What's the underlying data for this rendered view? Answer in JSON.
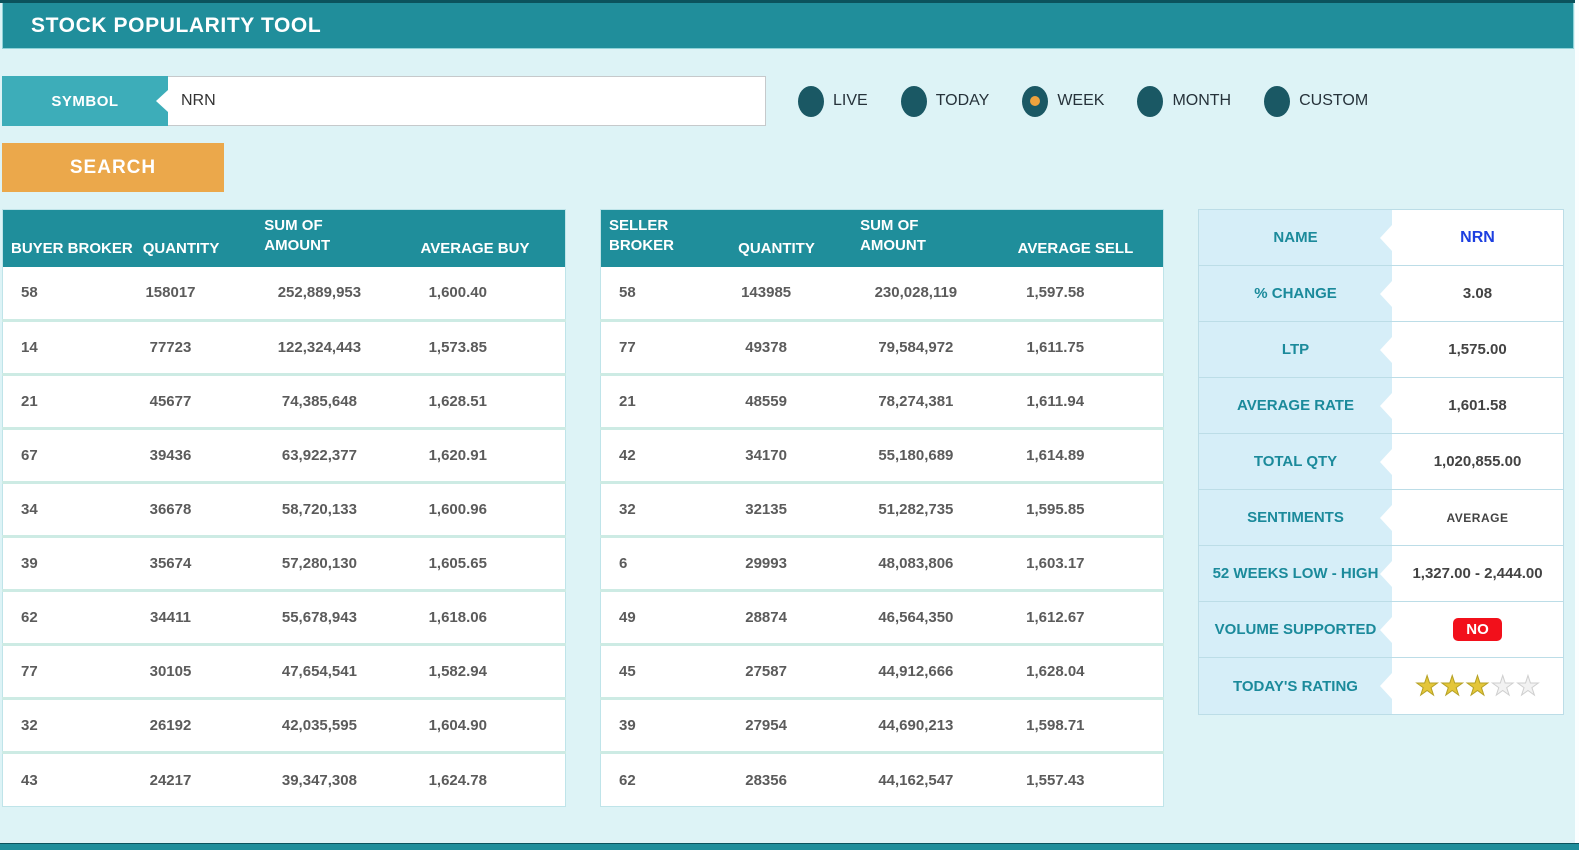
{
  "app": {
    "title": "STOCK POPULARITY TOOL"
  },
  "search": {
    "symbol_label": "SYMBOL",
    "symbol_value": "NRN",
    "search_button_label": "SEARCH"
  },
  "period_options": [
    {
      "label": "LIVE",
      "selected": false
    },
    {
      "label": "TODAY",
      "selected": false
    },
    {
      "label": "WEEK",
      "selected": true
    },
    {
      "label": "MONTH",
      "selected": false
    },
    {
      "label": "CUSTOM",
      "selected": false
    }
  ],
  "buyer_table": {
    "headers": [
      "BUYER BROKER",
      "QUANTITY",
      "SUM OF AMOUNT",
      "AVERAGE BUY"
    ],
    "rows": [
      [
        "58",
        "158017",
        "252,889,953",
        "1,600.40"
      ],
      [
        "14",
        "77723",
        "122,324,443",
        "1,573.85"
      ],
      [
        "21",
        "45677",
        "74,385,648",
        "1,628.51"
      ],
      [
        "67",
        "39436",
        "63,922,377",
        "1,620.91"
      ],
      [
        "34",
        "36678",
        "58,720,133",
        "1,600.96"
      ],
      [
        "39",
        "35674",
        "57,280,130",
        "1,605.65"
      ],
      [
        "62",
        "34411",
        "55,678,943",
        "1,618.06"
      ],
      [
        "77",
        "30105",
        "47,654,541",
        "1,582.94"
      ],
      [
        "32",
        "26192",
        "42,035,595",
        "1,604.90"
      ],
      [
        "43",
        "24217",
        "39,347,308",
        "1,624.78"
      ]
    ]
  },
  "seller_table": {
    "headers": [
      "SELLER BROKER",
      "QUANTITY",
      "SUM OF AMOUNT",
      "AVERAGE SELL"
    ],
    "rows": [
      [
        "58",
        "143985",
        "230,028,119",
        "1,597.58"
      ],
      [
        "77",
        "49378",
        "79,584,972",
        "1,611.75"
      ],
      [
        "21",
        "48559",
        "78,274,381",
        "1,611.94"
      ],
      [
        "42",
        "34170",
        "55,180,689",
        "1,614.89"
      ],
      [
        "32",
        "32135",
        "51,282,735",
        "1,595.85"
      ],
      [
        "6",
        "29993",
        "48,083,806",
        "1,603.17"
      ],
      [
        "49",
        "28874",
        "46,564,350",
        "1,612.67"
      ],
      [
        "45",
        "27587",
        "44,912,666",
        "1,628.04"
      ],
      [
        "39",
        "27954",
        "44,690,213",
        "1,598.71"
      ],
      [
        "62",
        "28356",
        "44,162,547",
        "1,557.43"
      ]
    ]
  },
  "summary_panel": {
    "rows": [
      {
        "label": "NAME",
        "value": "NRN",
        "type": "name"
      },
      {
        "label": "% CHANGE",
        "value": "3.08",
        "type": "text"
      },
      {
        "label": "LTP",
        "value": "1,575.00",
        "type": "text"
      },
      {
        "label": "AVERAGE RATE",
        "value": "1,601.58",
        "type": "text"
      },
      {
        "label": "TOTAL QTY",
        "value": "1,020,855.00",
        "type": "text"
      },
      {
        "label": "SENTIMENTS",
        "value": "AVERAGE",
        "type": "small"
      },
      {
        "label": "52 WEEKS LOW - HIGH",
        "value": "1,327.00 - 2,444.00",
        "type": "text"
      },
      {
        "label": "VOLUME SUPPORTED",
        "value": "NO",
        "type": "badge"
      },
      {
        "label": "TODAY'S RATING",
        "value": "3 of 5 stars",
        "type": "stars",
        "stars_filled": 3,
        "stars_total": 5
      }
    ],
    "star_glyph": "★"
  },
  "colors": {
    "header_teal": "#208e9b",
    "symbol_label_teal": "#3dadb9",
    "search_orange": "#eba84b",
    "radio_dark_teal": "#1a5864",
    "radio_selected_orange": "#efa23d",
    "table_header_teal": "#1f8e9b",
    "page_background": "#ddf3f6",
    "panel_label_blue": "#d6eef8",
    "panel_label_text": "#1b8a9b",
    "name_value_blue": "#1d3fe0",
    "badge_no_red": "#f2101b",
    "star_gold": "#e4c63a"
  }
}
